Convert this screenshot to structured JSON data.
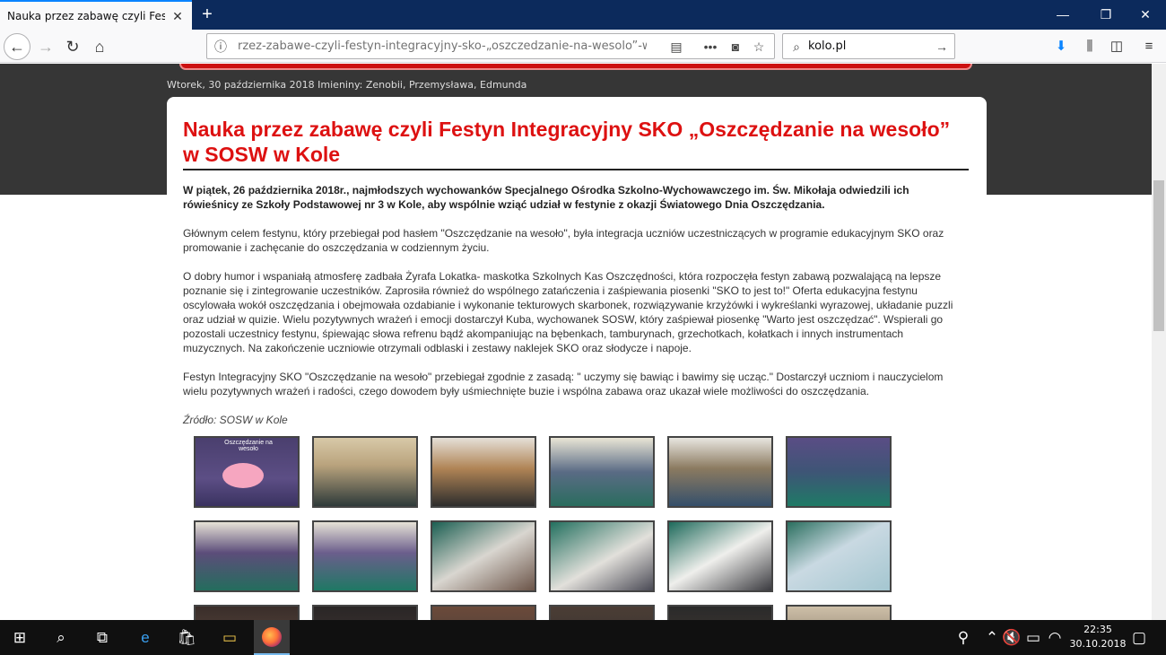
{
  "browser": {
    "tab_title": "Nauka przez zabawę czyli Festyn Int",
    "tab_close": "✕",
    "new_tab": "+",
    "url": "rzez-zabawe-czyli-festyn-integracyjny-sko-„oszczedzanie-na-wesolo”-w-sosw",
    "search_value": "kolo.pl",
    "window_controls": [
      "—",
      "❐",
      "✕"
    ]
  },
  "page": {
    "date_line": "Wtorek, 30 października 2018   Imieniny: Zenobii, Przemysława, Edmunda",
    "title": "Nauka przez zabawę czyli Festyn Integracyjny SKO „Oszczędzanie na wesoło” w SOSW w Kole",
    "lead": "W piątek, 26 października 2018r., najmłodszych wychowanków Specjalnego Ośrodka Szkolno-Wychowawczego im. Św. Mikołaja odwiedzili ich rówieśnicy ze Szkoły Podstawowej nr 3 w Kole, aby wspólnie wziąć udział w festynie z okazji Światowego Dnia Oszczędzania.",
    "p1": "Głównym celem festynu, który przebiegał pod hasłem \"Oszczędzanie na wesoło\", była integracja uczniów uczestniczących w programie edukacyjnym SKO oraz promowanie i zachęcanie do oszczędzania w codziennym życiu.",
    "p2": "O dobry humor i wspaniałą atmosferę zadbała Żyrafa Lokatka- maskotka Szkolnych Kas Oszczędności, która rozpoczęła festyn zabawą pozwalającą na lepsze poznanie się i zintegrowanie uczestników. Zaprosiła również do wspólnego zatańczenia i zaśpiewania piosenki \"SKO to jest to!\" Oferta edukacyjna festynu oscylowała wokół oszczędzania i obejmowała ozdabianie i wykonanie tekturowych skarbonek, rozwiązywanie krzyżówki i wykreślanki wyrazowej, układanie puzzli oraz udział w quizie. Wielu pozytywnych wrażeń i emocji dostarczył Kuba, wychowanek SOSW, który zaśpiewał piosenkę \"Warto jest oszczędzać\". Wspierali go pozostali uczestnicy festynu, śpiewając słowa refrenu bądź akompaniując na bębenkach, tamburynach, grzechotkach, kołatkach i innych instrumentach muzycznych. Na zakończenie uczniowie otrzymali odblaski i zestawy naklejek SKO oraz słodycze i napoje.",
    "p3": "Festyn Integracyjny SKO \"Oszczędzanie na wesoło\" przebiegał zgodnie z zasadą: \" uczymy się bawiąc i bawimy się ucząc.\" Dostarczył uczniom i nauczycielom wielu pozytywnych wrażeń i radości, czego dowodem były uśmiechnięte buzie i wspólna zabawa  oraz ukazał wiele możliwości do oszczędzania.",
    "source": "Źródło: SOSW w Kole",
    "thumb_sign": "Oszczędzanie na wesoło"
  },
  "taskbar": {
    "time": "22:35",
    "date": "30.10.2018"
  }
}
